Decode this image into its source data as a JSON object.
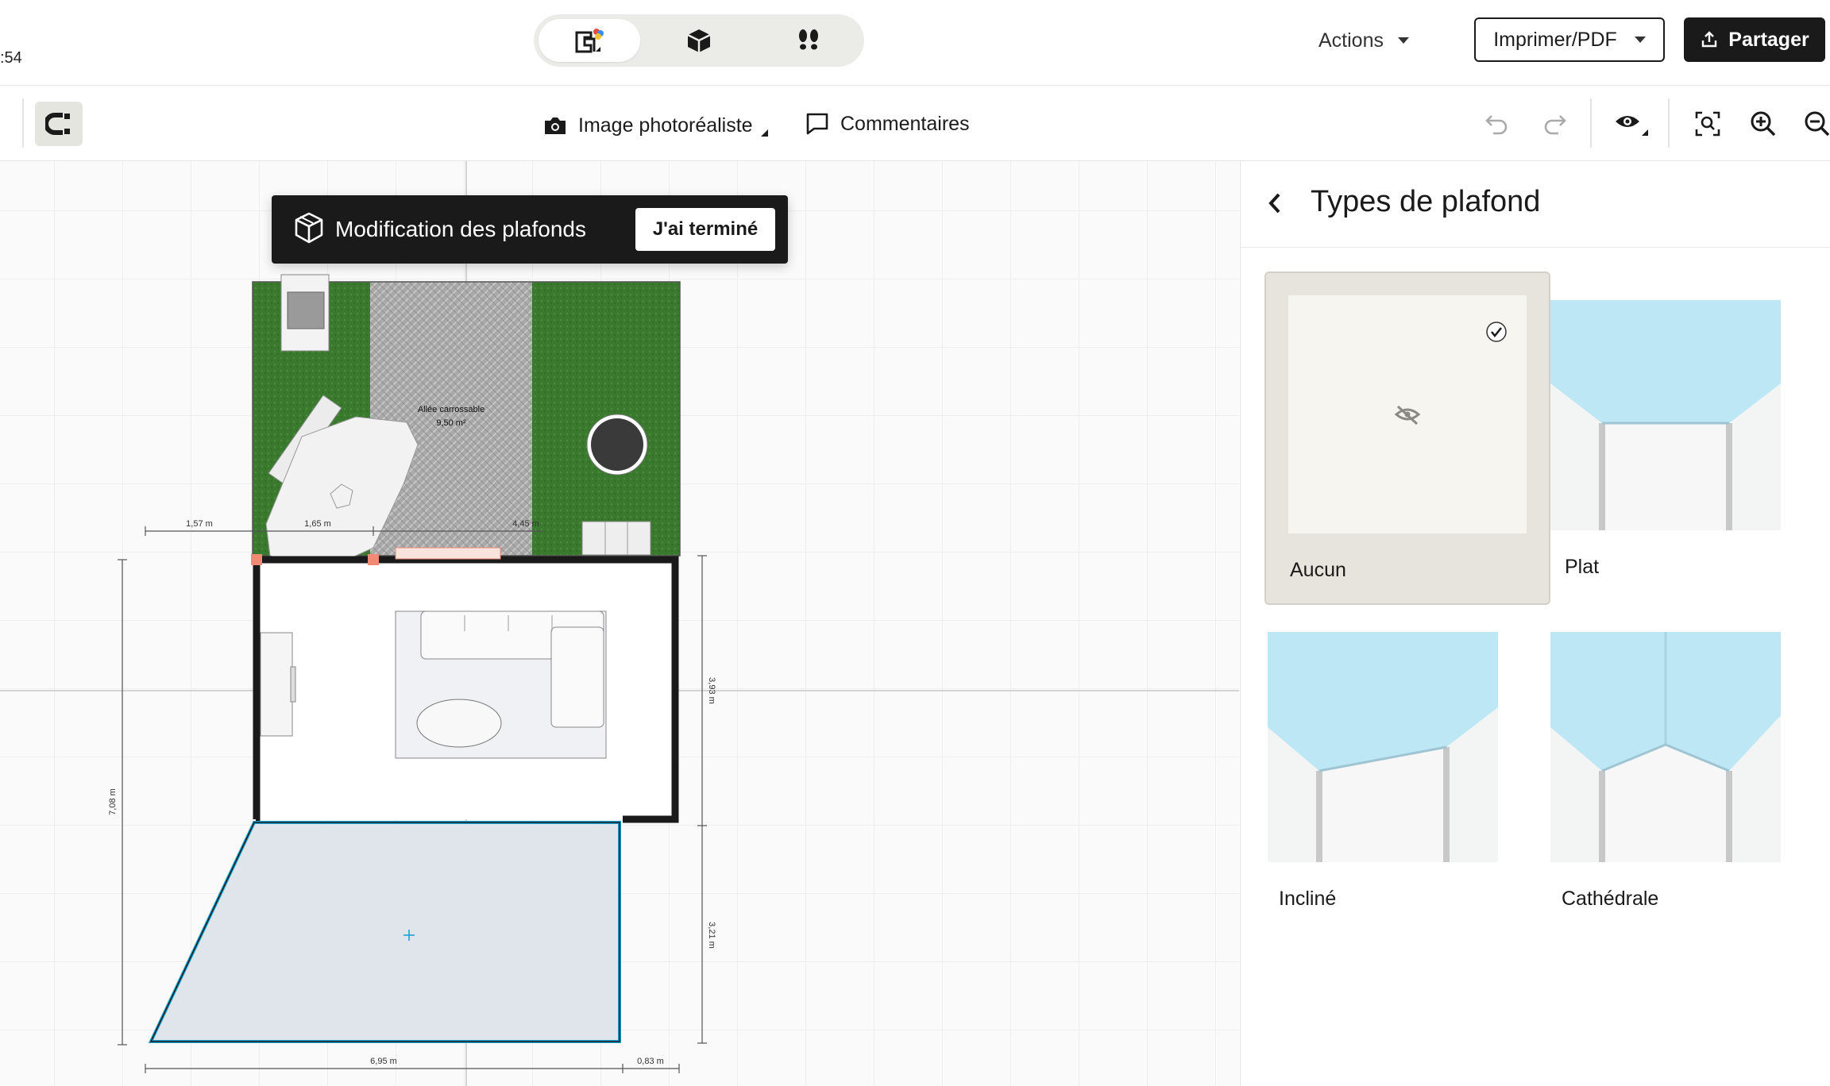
{
  "topbar": {
    "time_fragment": ":54",
    "view_modes": [
      {
        "name": "2d-plan",
        "active": true
      },
      {
        "name": "3d-view",
        "active": false
      },
      {
        "name": "walkthrough",
        "active": false
      }
    ],
    "actions_label": "Actions",
    "print_label": "Imprimer/PDF",
    "share_label": "Partager"
  },
  "toolbar": {
    "photo_label": "Image photoréaliste",
    "comments_label": "Commentaires"
  },
  "banner": {
    "title": "Modification des plafonds",
    "done_label": "J'ai terminé"
  },
  "plan": {
    "driveway_label": "Allée carrossable",
    "driveway_area": "9,50 m²",
    "dimensions": {
      "top_1": "1,57 m",
      "top_2": "1,65 m",
      "top_3": "4,45 m",
      "left_height": "7,08 m",
      "right_upper": "3,93 m",
      "right_lower": "3,21 m",
      "bottom_1": "6,95 m",
      "bottom_2": "0,83 m"
    }
  },
  "panel": {
    "title": "Types de plafond",
    "types": [
      {
        "label": "Aucun",
        "selected": true
      },
      {
        "label": "Plat",
        "selected": false
      },
      {
        "label": "Incliné",
        "selected": false
      },
      {
        "label": "Cathédrale",
        "selected": false
      }
    ]
  },
  "colors": {
    "accent_dark": "#1a1a1a",
    "selection_blue": "#1aa3d1",
    "grass": "#3a7a2e",
    "ceiling_sky": "#bde7f5"
  }
}
